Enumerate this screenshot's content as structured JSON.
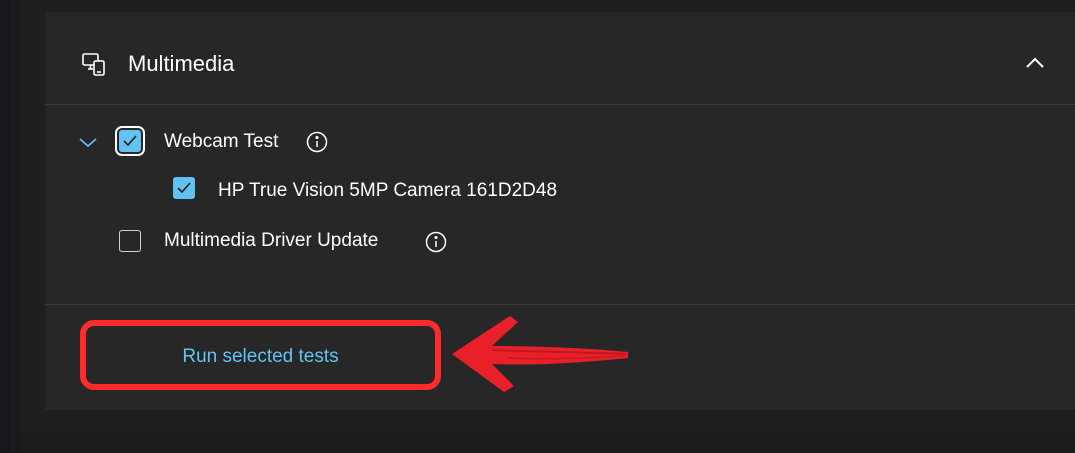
{
  "section": {
    "title": "Multimedia",
    "icon": "devices-icon"
  },
  "tests": [
    {
      "label": "Webcam Test",
      "checked": true,
      "expanded": true,
      "children": [
        {
          "label": "HP True Vision 5MP Camera 161D2D48",
          "checked": true
        }
      ]
    },
    {
      "label": "Multimedia Driver Update",
      "checked": false
    }
  ],
  "actions": {
    "run_label": "Run selected tests"
  },
  "annotation": {
    "color": "#ff2a2a",
    "type": "arrow-pointing-left"
  },
  "colors": {
    "accent": "#62c2f2",
    "card_bg": "#272727"
  }
}
